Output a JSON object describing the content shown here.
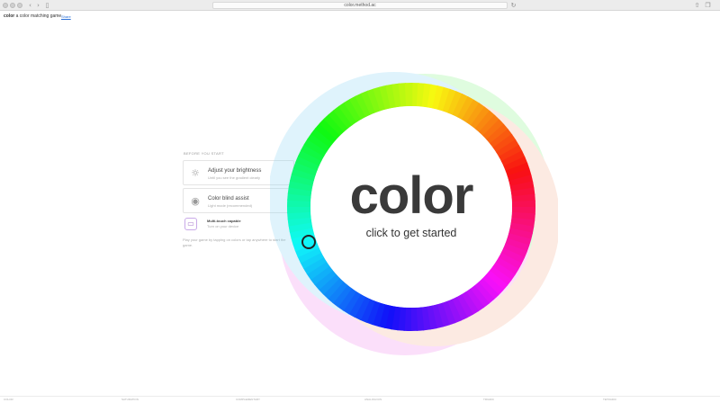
{
  "browser": {
    "url": "color.method.ac",
    "back_icon": "chevron-left-icon",
    "forward_icon": "chevron-right-icon",
    "sidebar_icon": "sidebar-icon",
    "reload_icon": "reload-icon",
    "share_icon": "share-icon",
    "tabs_icon": "tabs-icon"
  },
  "header": {
    "brand": "color",
    "tagline": "a color matching game",
    "share_link": "Share"
  },
  "panel": {
    "title": "Before you start",
    "cards": [
      {
        "icon": "sun-icon",
        "title": "Adjust your brightness",
        "subtitle": "Until you see the gradient clearly"
      },
      {
        "icon": "eye-icon",
        "title": "Color blind assist",
        "subtitle": "Light mode (recommended)"
      }
    ],
    "mini": {
      "icon": "screen-icon",
      "title": "Multi-touch capable",
      "subtitle": "Turn on your device"
    },
    "note": "Play your game by tapping on colors or tap anywhere to start the game."
  },
  "hero": {
    "title": "color",
    "subtitle": "click to get started"
  },
  "footer": {
    "links": [
      "Color",
      "Saturation",
      "Complementary",
      "Analogous",
      "Triadic",
      "Tetradic"
    ]
  },
  "colors": {
    "accent_link": "#2a6fd6",
    "title_text": "#3a3a3a"
  }
}
